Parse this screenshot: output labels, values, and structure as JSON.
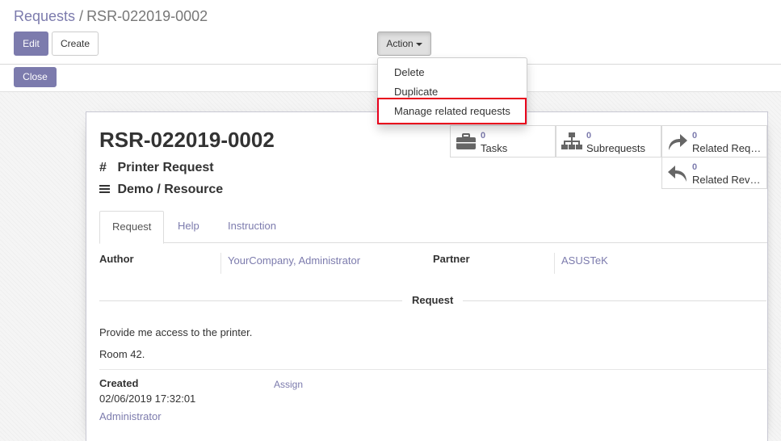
{
  "breadcrumb": {
    "parent": "Requests",
    "separator": "/",
    "current": "RSR-022019-0002"
  },
  "toolbar": {
    "edit_label": "Edit",
    "create_label": "Create",
    "action_label": "Action"
  },
  "action_menu": {
    "items": [
      {
        "label": "Delete"
      },
      {
        "label": "Duplicate"
      },
      {
        "label": "Manage related requests"
      }
    ]
  },
  "statusbar": {
    "close_label": "Close"
  },
  "record": {
    "name": "RSR-022019-0002",
    "type": "Printer Request",
    "category": "Demo / Resource"
  },
  "smart_buttons": [
    {
      "value": "0",
      "label": "Tasks",
      "icon": "briefcase-icon"
    },
    {
      "value": "0",
      "label": "Subrequests",
      "icon": "sitemap-icon"
    },
    {
      "value": "0",
      "label": "Related Req…",
      "icon": "share-icon"
    },
    {
      "value": "0",
      "label": "Related Rev…",
      "icon": "reply-icon"
    }
  ],
  "tabs": [
    {
      "label": "Request"
    },
    {
      "label": "Help"
    },
    {
      "label": "Instruction"
    }
  ],
  "fields": {
    "author_label": "Author",
    "author_value": "YourCompany, Administrator",
    "partner_label": "Partner",
    "partner_value": "ASUSTeK"
  },
  "request_section": {
    "title": "Request",
    "lines": [
      "Provide me access to the printer.",
      "Room 42."
    ]
  },
  "footer": {
    "created_label": "Created",
    "created_value": "02/06/2019 17:32:01",
    "created_by": "Administrator",
    "assign_label": "Assign"
  },
  "colors": {
    "accent": "#7c7bad",
    "highlight_border": "#e8001c"
  }
}
